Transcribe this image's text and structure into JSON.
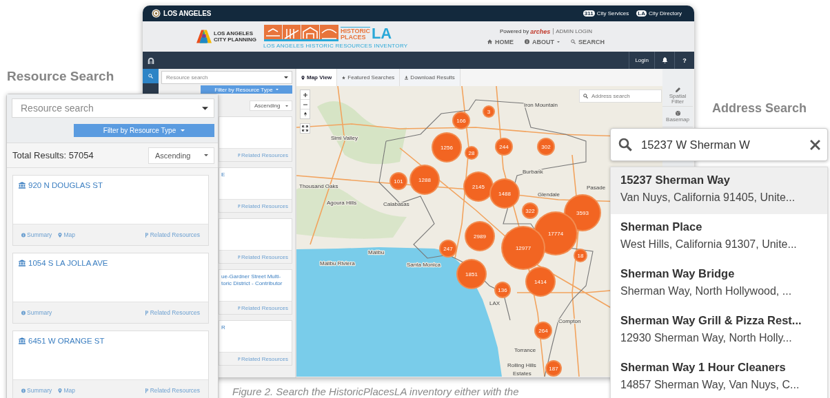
{
  "resource_search_label": "Resource Search",
  "address_search_label": "Address Search",
  "app": {
    "top_bar": {
      "city": "LOS ANGELES",
      "links": [
        {
          "badge": "311",
          "label": "City Services"
        },
        {
          "badge": "LA",
          "label": "City Directory"
        }
      ]
    },
    "header": {
      "planning_logo": [
        "LOS ANGELES",
        "CITY PLANNING"
      ],
      "logo": {
        "line_1": "HISTORIC",
        "line_2": "PLACES",
        "mark": "LA",
        "subtitle": "LOS ANGELES HISTORIC RESOURCES INVENTORY"
      },
      "powered_by": "Powered by",
      "arches": "arches",
      "admin_login": "ADMIN LOGIN",
      "nav": [
        {
          "kind": "home",
          "label": "HOME",
          "dropdown": false
        },
        {
          "kind": "info",
          "label": "ABOUT",
          "dropdown": true
        },
        {
          "kind": "search",
          "label": "SEARCH",
          "dropdown": false
        }
      ]
    },
    "toolbar": {
      "login": "Login",
      "help": "?"
    },
    "search": {
      "placeholder": "Resource search",
      "filter_button": "Filter by Resource Type",
      "sort": "Ascending"
    },
    "cards": [
      {
        "link": "Related Resources"
      },
      {
        "title": "E",
        "link": "Related Resources"
      },
      {
        "link": "Related Resources"
      },
      {
        "title": "ue-Gardner Street Multi-\ntoric District - Contributor",
        "link": "Related Resources"
      },
      {
        "title": "R",
        "link": "Related Resources"
      }
    ],
    "tabs": [
      {
        "kind": "map",
        "label": "Map View",
        "selected": true
      },
      {
        "kind": "star",
        "label": "Featured Searches",
        "selected": false
      },
      {
        "kind": "download",
        "label": "Download Results",
        "selected": false
      }
    ],
    "map": {
      "address_placeholder": "Address search",
      "places": [
        "Iron Mountain",
        "Simi Valley",
        "Thousand Oaks",
        "Agoura Hills",
        "Calabasas",
        "Burbank",
        "Glendale",
        "Pasade",
        "Malibu",
        "Malibu Riviera",
        "Santa Monica",
        "LAX",
        "Compton",
        "Torrance",
        "Rolling Hills",
        "Estates"
      ],
      "clusters": [
        "3",
        "166",
        "1256",
        "28",
        "244",
        "302",
        "101",
        "1288",
        "2145",
        "1488",
        "322",
        "3593",
        "2989",
        "17774",
        "12977",
        "18",
        "247",
        "1851",
        "136",
        "1414",
        "264",
        "187"
      ]
    },
    "tools": [
      {
        "kind": "pencil",
        "label": "Spatial Filter"
      },
      {
        "kind": "globe",
        "label": "Basemap"
      }
    ]
  },
  "resource_panel": {
    "placeholder": "Resource search",
    "filter_button": "Filter by Resource Type",
    "total": "Total Results: 57054",
    "sort": "Ascending",
    "cards": [
      {
        "title": "920 N DOUGLAS ST",
        "links": [
          {
            "kind": "summary",
            "label": "Summary"
          },
          {
            "kind": "map",
            "label": "Map"
          }
        ],
        "related": "Related Resources"
      },
      {
        "title": "1054 S LA JOLLA AVE",
        "links": [
          {
            "kind": "summary",
            "label": "Summary"
          }
        ],
        "related": "Related Resources"
      },
      {
        "title": "6451 W ORANGE ST",
        "links": [
          {
            "kind": "summary",
            "label": "Summary"
          },
          {
            "kind": "map",
            "label": "Map"
          }
        ],
        "related": "Related Resources"
      }
    ]
  },
  "address_panel": {
    "value": "15237 W Sherman W",
    "results": [
      {
        "name": "15237 Sherman Way",
        "address": "Van Nuys, California 91405, Unite...",
        "selected": true
      },
      {
        "name": "Sherman Place",
        "address": "West Hills, California 91307, Unite...",
        "selected": false
      },
      {
        "name": "Sherman Way Bridge",
        "address": "Sherman Way, North Hollywood, ...",
        "selected": false
      },
      {
        "name": "Sherman Way Grill & Pizza Rest...",
        "address": "12930 Sherman Way, North Holly...",
        "selected": false
      },
      {
        "name": "Sherman Way 1 Hour Cleaners",
        "address": "14857 Sherman Way, Van Nuys, C...",
        "selected": false
      }
    ]
  },
  "caption": "Figure 2. Search the HistoricPlacesLA inventory either with the"
}
